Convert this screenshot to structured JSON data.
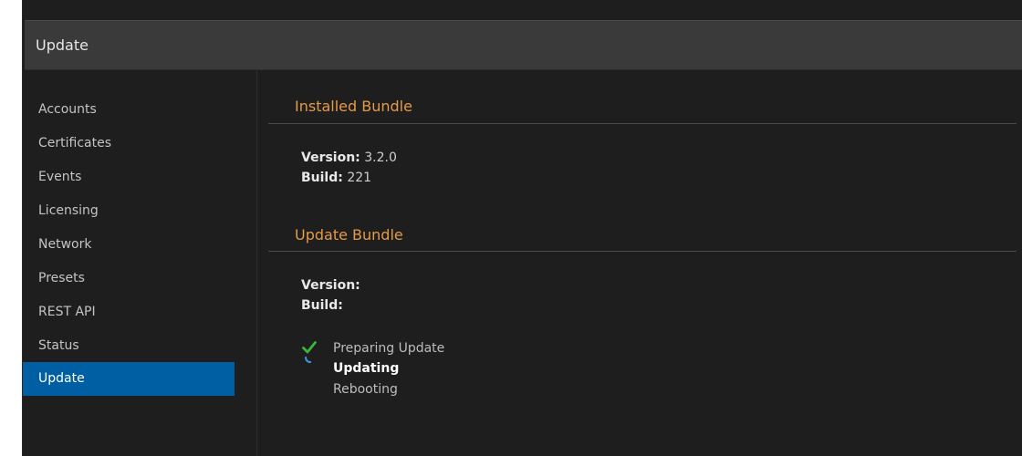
{
  "page": {
    "title": "Update"
  },
  "sidebar": {
    "items": [
      {
        "label": "Accounts",
        "active": false
      },
      {
        "label": "Certificates",
        "active": false
      },
      {
        "label": "Events",
        "active": false
      },
      {
        "label": "Licensing",
        "active": false
      },
      {
        "label": "Network",
        "active": false
      },
      {
        "label": "Presets",
        "active": false
      },
      {
        "label": "REST API",
        "active": false
      },
      {
        "label": "Status",
        "active": false
      },
      {
        "label": "Update",
        "active": true
      }
    ]
  },
  "installed_bundle": {
    "title": "Installed Bundle",
    "version_label": "Version:",
    "version_value": "3.2.0",
    "build_label": "Build:",
    "build_value": "221"
  },
  "update_bundle": {
    "title": "Update Bundle",
    "version_label": "Version:",
    "version_value": "",
    "build_label": "Build:",
    "build_value": ""
  },
  "progress": {
    "steps": [
      {
        "label": "Preparing Update",
        "state": "done",
        "icon": "checkmark-icon"
      },
      {
        "label": "Updating",
        "state": "in-progress",
        "icon": "spinner-icon"
      },
      {
        "label": "Rebooting",
        "state": "pending",
        "icon": ""
      }
    ]
  },
  "colors": {
    "background": "#1e1e1e",
    "header": "#3a3a3a",
    "accent_orange": "#e59a48",
    "active_blue": "#005fa3",
    "check_green": "#3cb43c",
    "spinner_blue": "#3b8fd6"
  }
}
